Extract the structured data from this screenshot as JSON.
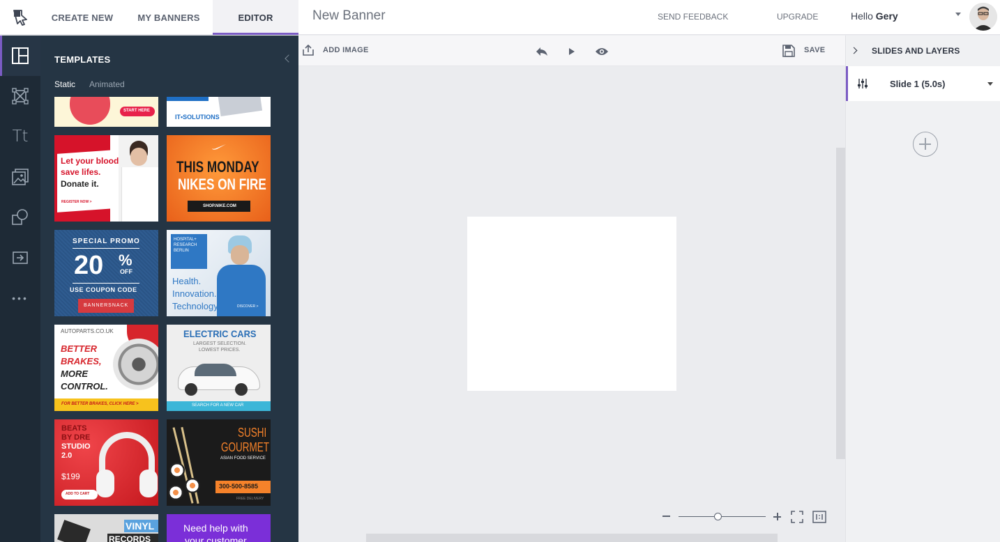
{
  "nav": {
    "create_new": "CREATE NEW",
    "my_banners": "MY BANNERS",
    "editor": "EDITOR",
    "doc_title": "New Banner",
    "send_feedback": "SEND FEEDBACK",
    "upgrade": "UPGRADE",
    "greeting": "Hello",
    "user_name": "Gery"
  },
  "rail": {
    "icons": [
      "templates-icon",
      "crop-icon",
      "text-icon",
      "image-icon",
      "shapes-icon",
      "import-icon",
      "more-icon"
    ],
    "text_glyph": "Tt",
    "more_glyph": "•••"
  },
  "panel": {
    "title": "TEMPLATES",
    "tabs": {
      "static": "Static",
      "animated": "Animated"
    },
    "templates": {
      "fitness": {
        "cta": "START HERE"
      },
      "it": {
        "text": "IT•SOLUTIONS"
      },
      "blood": {
        "line1": "Let your blood",
        "line2": "save lifes.",
        "line3": "Donate it.",
        "cta": "REGISTER NOW >"
      },
      "nike": {
        "line1": "THIS MONDAY",
        "line2": "NIKES ON FIRE",
        "cta": "SHOP.NIKE.COM"
      },
      "promo": {
        "line1": "SPECIAL PROMO",
        "value": "20",
        "pct": "%",
        "off": "OFF",
        "line2": "USE COUPON CODE",
        "code": "BANNERSNACK"
      },
      "hospital": {
        "badge1": "HOSPITAL+",
        "badge2": "RESEARCH",
        "badge3": "BERLIN",
        "line1": "Health.",
        "line2": "Innovation.",
        "line3": "Technology",
        "cta": "DISCOVER >"
      },
      "autoparts": {
        "site": "AUTOPARTS.CO.UK",
        "line1": "BETTER",
        "line2": "BRAKES,",
        "line3": "MORE",
        "line4": "CONTROL.",
        "cta": "FOR BETTER BRAKES, CLICK HERE >"
      },
      "ecars": {
        "title": "ELECTRIC CARS",
        "sub1": "LARGEST SELECTION.",
        "sub2": "LOWEST PRICES.",
        "cta": "SEARCH FOR A NEW CAR"
      },
      "beats": {
        "line1": "BEATS",
        "line2": "BY DRE",
        "line3": "STUDIO",
        "line4": "2.0",
        "price": "$199",
        "cta": "ADD TO CART"
      },
      "sushi": {
        "line1": "SUSHI",
        "line2": "GOURMET",
        "line3": "ASIAN FOOD SERVICE",
        "phone": "300-500-8585",
        "foot": "FREE DELIVERY"
      },
      "vinyl": {
        "line1": "VINYL",
        "line2": "RECORDS"
      },
      "help": {
        "line1": "Need help with",
        "line2": "your customer"
      }
    }
  },
  "toolbar": {
    "add_image": "ADD IMAGE",
    "save": "SAVE"
  },
  "right_panel": {
    "title": "SLIDES AND LAYERS",
    "slide_label": "Slide 1 (5.0s)"
  },
  "zoom": {
    "level": 0.45
  },
  "colors": {
    "accent": "#7b5cc4",
    "rail_bg": "#1e2a36",
    "panel_bg": "#253544"
  }
}
